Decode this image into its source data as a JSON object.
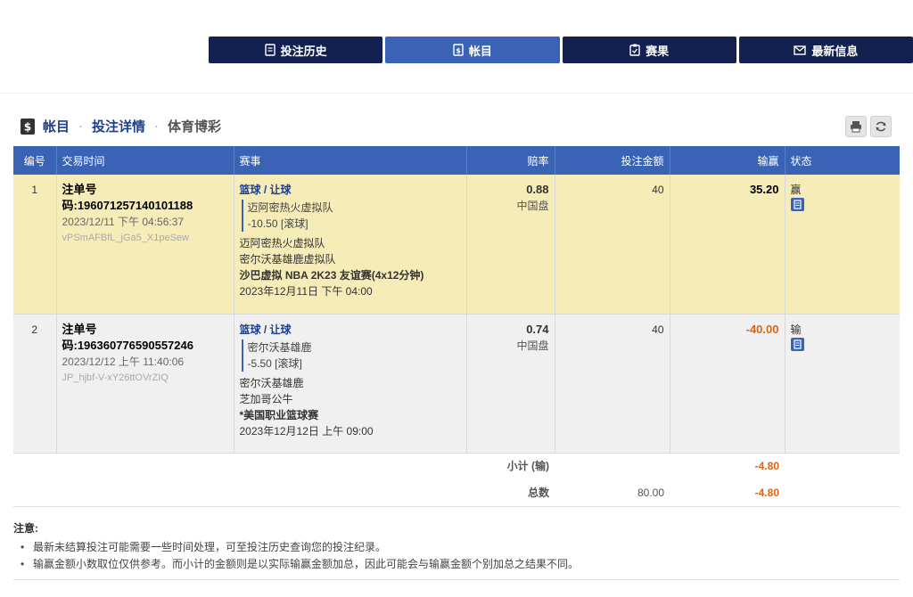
{
  "nav": [
    {
      "label": "投注历史",
      "icon": "receipt-icon",
      "active": false
    },
    {
      "label": "帐目",
      "icon": "dollar-doc-icon",
      "active": true
    },
    {
      "label": "赛果",
      "icon": "clipboard-icon",
      "active": false
    },
    {
      "label": "最新信息",
      "icon": "mail-icon",
      "active": false
    }
  ],
  "breadcrumb": {
    "item1": "帐目",
    "item2": "投注详情",
    "item3": "体育博彩"
  },
  "table": {
    "headers": {
      "no": "编号",
      "time": "交易时间",
      "event": "赛事",
      "odds": "赔率",
      "stake": "投注金额",
      "winloss": "输赢",
      "status": "状态"
    },
    "rows": [
      {
        "no": "1",
        "ticket_label": "注单号",
        "ticket_no": "码:196071257140101188",
        "datetime": "2023/12/11 下午 04:56:37",
        "code": "vPSmAFBfL_jGa5_X1peSew",
        "sport": "篮球 / 让球",
        "selection": "迈阿密热火虚拟队",
        "handicap": "-10.50 [滚球]",
        "team1": "迈阿密热火虚拟队",
        "team2": "密尔沃基雄鹿虚拟队",
        "league": "沙巴虚拟 NBA 2K23 友谊赛(4x12分钟)",
        "match_time": "2023年12月11日 下午 04:00",
        "odds": "0.88",
        "market": "中国盘",
        "stake": "40",
        "winloss": "35.20",
        "status": "赢"
      },
      {
        "no": "2",
        "ticket_label": "注单号",
        "ticket_no": "码:196360776590557246",
        "datetime": "2023/12/12 上午 11:40:06",
        "code": "JP_hjbf-V-xY26ttOVrZIQ",
        "sport": "篮球 / 让球",
        "selection": "密尔沃基雄鹿",
        "handicap": "-5.50 [滚球]",
        "team1": "密尔沃基雄鹿",
        "team2": "芝加哥公牛",
        "league": "*美国职业篮球赛",
        "match_time": "2023年12月12日 上午 09:00",
        "odds": "0.74",
        "market": "中国盘",
        "stake": "40",
        "winloss": "-40.00",
        "status": "输"
      }
    ],
    "subtotal": {
      "label": "小计 (输)",
      "winloss": "-4.80"
    },
    "total": {
      "label": "总数",
      "stake": "80.00",
      "winloss": "-4.80"
    }
  },
  "notes": {
    "title": "注意:",
    "items": [
      "最新未结算投注可能需要一些时间处理，可至投注历史查询您的投注纪录。",
      "输赢金额小数取位仅供参考。而小计的金额则是以实际输赢金额加总，因此可能会与输赢金额个别加总之结果不同。"
    ]
  },
  "colors": {
    "nav": "#12214f",
    "accent": "#3a63b5",
    "win_row": "#f5ecb8",
    "loss_text": "#e0630f"
  }
}
